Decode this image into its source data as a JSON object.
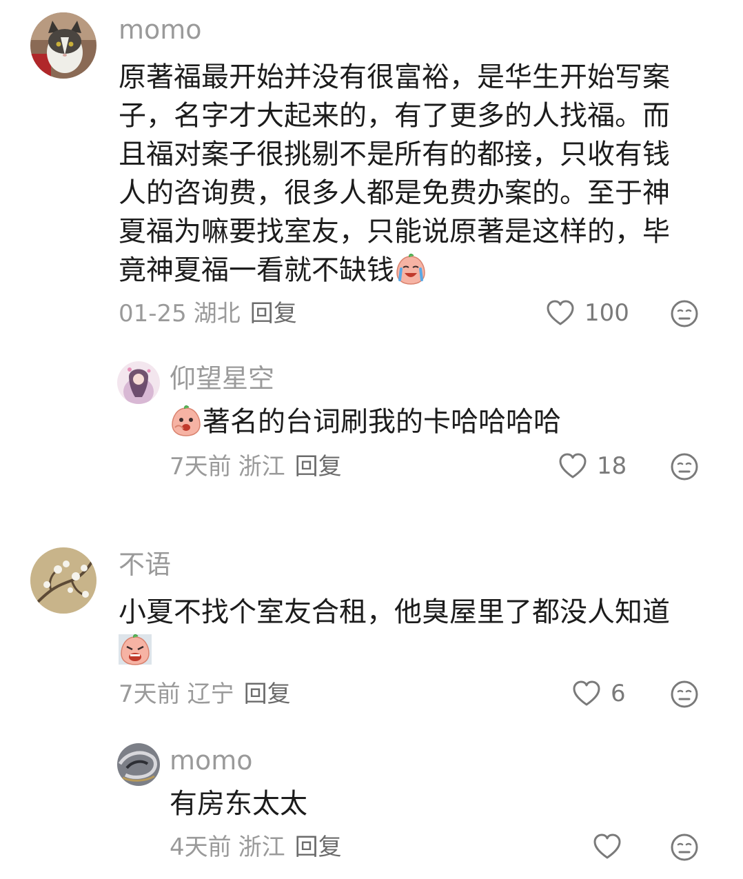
{
  "comments": [
    {
      "username": "momo",
      "lines": [
        "原著福最开始并没有很富裕，是华生开始写案",
        "子，名字才大起来的，有了更多的人找福。而",
        "且福对案子很挑剔不是所有的都接，只收有钱",
        "人的咨询费，很多人都是免费办案的。至于神",
        "夏福为嘛要找室友，只能说原著是这样的，毕",
        "竟神夏福一看就不缺钱"
      ],
      "emoji": "crying-face-emoji",
      "date": "01-25",
      "location": "湖北",
      "reply_label": "回复",
      "likes": "100",
      "replies": [
        {
          "username": "仰望星空",
          "text": "著名的台词刷我的卡哈哈哈哈",
          "emoji": "laughing-face-emoji",
          "date": "7天前",
          "location": "浙江",
          "reply_label": "回复",
          "likes": "18"
        }
      ]
    },
    {
      "username": "不语",
      "lines": [
        "小夏不找个室友合租，他臭屋里了都没人知道"
      ],
      "emoji": "angry-face-emoji",
      "date": "7天前",
      "location": "辽宁",
      "reply_label": "回复",
      "likes": "6",
      "replies": [
        {
          "username": "momo",
          "text": "有房东太太",
          "date": "4天前",
          "location": "浙江",
          "reply_label": "回复",
          "likes": ""
        }
      ]
    }
  ],
  "colors": {
    "username": "#9a9a9a",
    "text": "#1c1c1c",
    "meta": "#9a9a9a",
    "icon": "#7a7a7a"
  }
}
